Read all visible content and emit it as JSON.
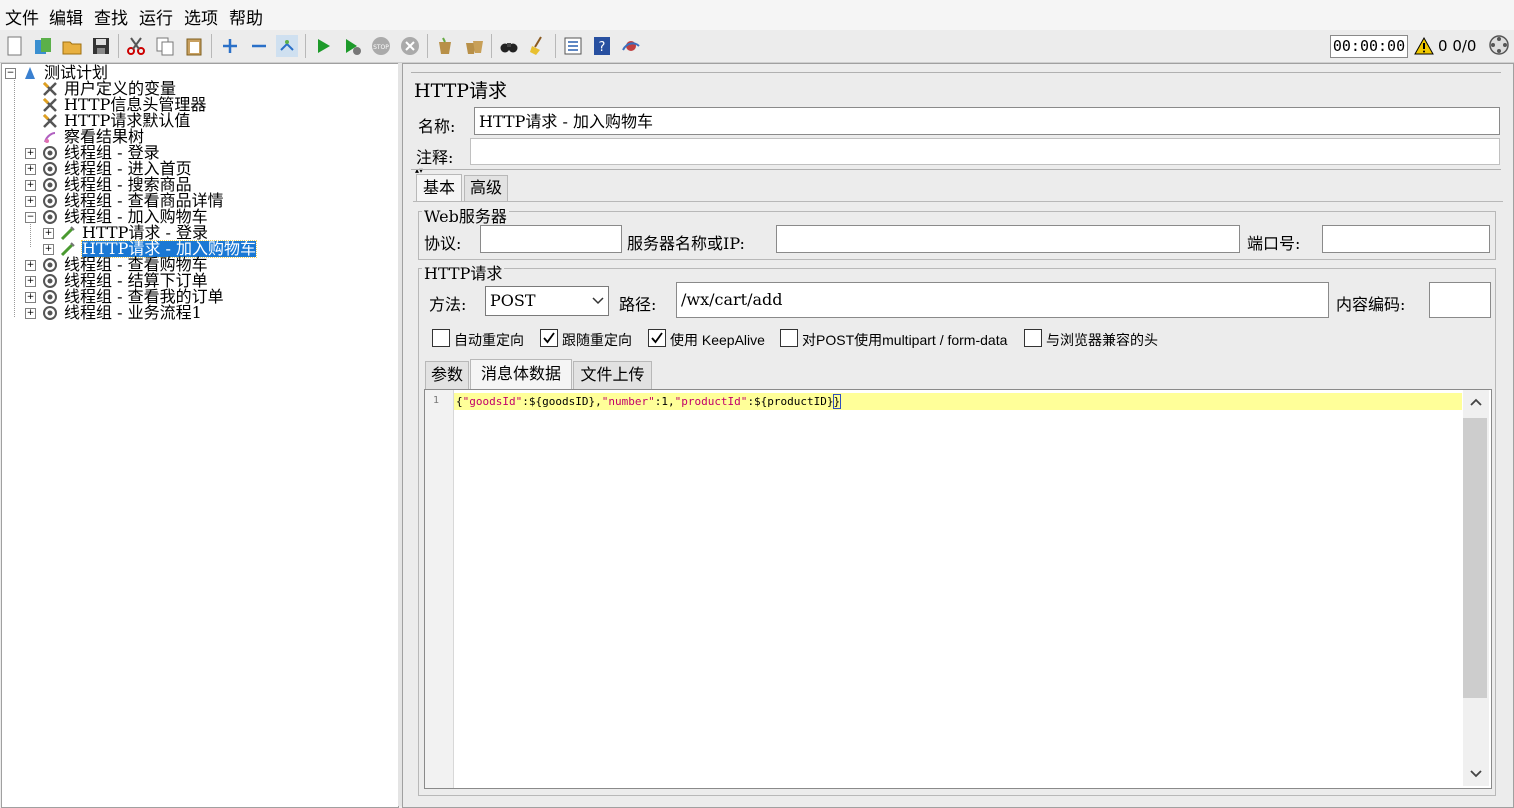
{
  "menu": [
    "文件",
    "编辑",
    "查找",
    "运行",
    "选项",
    "帮助"
  ],
  "toolbar": {
    "icons": [
      "new-icon",
      "templates-icon",
      "open-icon",
      "save-icon",
      "cut-icon",
      "copy-icon",
      "paste-icon",
      "expand-icon",
      "collapse-icon",
      "toggle-icon",
      "start-icon",
      "start-no-pause-icon",
      "stop-icon",
      "shutdown-icon",
      "clear-icon",
      "clear-all-icon",
      "search-icon",
      "reset-search-icon",
      "function-helper-icon",
      "help-icon",
      "remote-icon"
    ],
    "timer": "00:00:00",
    "warn_count": "0",
    "threads": "0/0"
  },
  "tree": {
    "items": [
      {
        "label": "测试计划",
        "icon": "test-plan-icon"
      },
      {
        "label": "用户定义的变量",
        "icon": "config-icon"
      },
      {
        "label": "HTTP信息头管理器",
        "icon": "config-icon"
      },
      {
        "label": "HTTP请求默认值",
        "icon": "config-icon"
      },
      {
        "label": "察看结果树",
        "icon": "listener-icon"
      },
      {
        "label": "线程组 - 登录",
        "icon": "thread-group-icon"
      },
      {
        "label": "线程组 - 进入首页",
        "icon": "thread-group-icon"
      },
      {
        "label": "线程组 - 搜索商品",
        "icon": "thread-group-icon"
      },
      {
        "label": "线程组 - 查看商品详情",
        "icon": "thread-group-icon"
      },
      {
        "label": "线程组 - 加入购物车",
        "icon": "thread-group-icon"
      },
      {
        "label": "HTTP请求 - 登录",
        "icon": "sampler-icon"
      },
      {
        "label": "HTTP请求 - 加入购物车",
        "icon": "sampler-icon",
        "selected": true
      },
      {
        "label": "线程组 - 查看购物车",
        "icon": "thread-group-icon"
      },
      {
        "label": "线程组 - 结算下订单",
        "icon": "thread-group-icon"
      },
      {
        "label": "线程组 - 查看我的订单",
        "icon": "thread-group-icon"
      },
      {
        "label": "线程组 - 业务流程1",
        "icon": "thread-group-icon"
      }
    ]
  },
  "panel": {
    "title": "HTTP请求",
    "name_label": "名称:",
    "name_value": "HTTP请求 - 加入购物车",
    "comment_label": "注释:",
    "comment_value": "",
    "tabs": [
      "基本",
      "高级"
    ],
    "web_server": {
      "legend": "Web服务器",
      "protocol_label": "协议:",
      "protocol_value": "",
      "server_label": "服务器名称或IP:",
      "server_value": "",
      "port_label": "端口号:",
      "port_value": ""
    },
    "http_request": {
      "legend": "HTTP请求",
      "method_label": "方法:",
      "method_value": "POST",
      "path_label": "路径:",
      "path_value": "/wx/cart/add",
      "encoding_label": "内容编码:",
      "encoding_value": ""
    },
    "checkboxes": [
      {
        "label": "自动重定向",
        "checked": false
      },
      {
        "label": "跟随重定向",
        "checked": true
      },
      {
        "label": "使用 KeepAlive",
        "checked": true
      },
      {
        "label": "对POST使用multipart / form-data",
        "checked": false
      },
      {
        "label": "与浏览器兼容的头",
        "checked": false
      }
    ],
    "subtabs": [
      "参数",
      "消息体数据",
      "文件上传"
    ],
    "body": {
      "line_number": "1",
      "t1": "{",
      "t2": "\"goodsId\"",
      "t3": ":${goodsID},",
      "t4": "\"number\"",
      "t5": ":1,",
      "t6": "\"productId\"",
      "t7": ":${productID}",
      "t8": "}"
    }
  },
  "colors": {
    "selection": "#1a78d4",
    "highlight_line": "#ffff99",
    "json_key": "#c0006a"
  }
}
